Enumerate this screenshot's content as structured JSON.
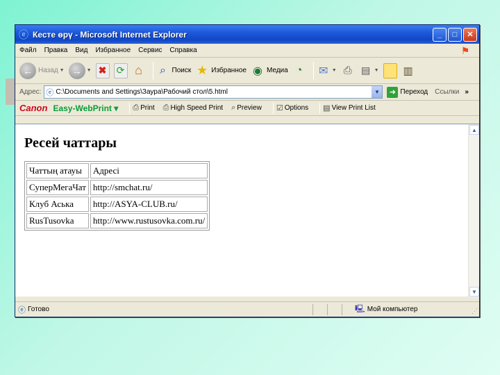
{
  "window": {
    "title": "Кесте өрү - Microsoft Internet Explorer",
    "buttons": {
      "minimize": "_",
      "maximize": "□",
      "close": "✕"
    }
  },
  "menu": [
    "Файл",
    "Правка",
    "Вид",
    "Избранное",
    "Сервис",
    "Справка"
  ],
  "toolbar": {
    "back": "Назад",
    "search": "Поиск",
    "favorites": "Избранное",
    "media": "Медиа"
  },
  "address": {
    "label": "Адрес:",
    "value": "C:\\Documents and Settings\\Заура\\Рабочий стол\\5.html",
    "go": "Переход",
    "links": "Ссылки",
    "more": "»"
  },
  "canon": {
    "logo": "Canon",
    "app": "Easy-WebPrint ▾",
    "print": "Print",
    "high_speed_print": "High Speed Print",
    "preview": "Preview",
    "options": "Options",
    "view_print_list": "View Print List"
  },
  "page": {
    "heading": "Ресей чаттары",
    "table": {
      "header": [
        "Чаттың атауы",
        "Адресі"
      ],
      "rows": [
        [
          "СуперМегаЧат",
          "http://smchat.ru/"
        ],
        [
          "Клуб Аська",
          "http://ASYA-CLUB.ru/"
        ],
        [
          "RusTusovka",
          "http://www.rustusovka.com.ru/"
        ]
      ]
    }
  },
  "status": {
    "text": "Готово",
    "zone": "Мой компьютер"
  }
}
